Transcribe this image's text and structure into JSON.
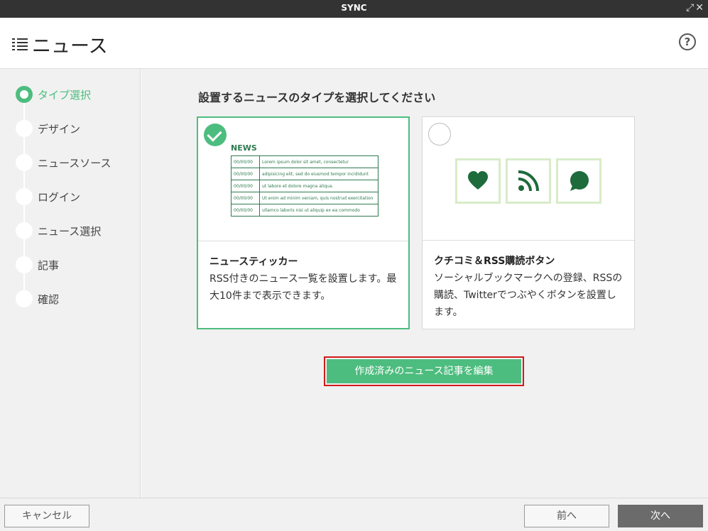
{
  "window": {
    "title": "SYNC"
  },
  "header": {
    "title": "ニュース",
    "help": "?"
  },
  "sidebar": {
    "steps": [
      {
        "label": "タイプ選択",
        "active": true
      },
      {
        "label": "デザイン",
        "active": false
      },
      {
        "label": "ニュースソース",
        "active": false
      },
      {
        "label": "ログイン",
        "active": false
      },
      {
        "label": "ニュース選択",
        "active": false
      },
      {
        "label": "記事",
        "active": false
      },
      {
        "label": "確認",
        "active": false
      }
    ]
  },
  "main": {
    "heading": "設置するニュースのタイプを選択してください",
    "cards": [
      {
        "name": "ニュースティッカー",
        "description": "RSS付きのニュース一覧を設置します。最大10件まで表示できます。",
        "selected": true,
        "preview": {
          "title": "NEWS",
          "rows": [
            {
              "date": "00/00/00",
              "text": "Lorem ipsum dolor sit amet, consectetur"
            },
            {
              "date": "00/00/00",
              "text": "adipisicing elit, sed do eiusmod tempor incididunt"
            },
            {
              "date": "00/00/00",
              "text": "ut labore et dolore magna aliqua."
            },
            {
              "date": "00/00/00",
              "text": "Ut enim ad minim veniam, quis nostrud exercitation"
            },
            {
              "date": "00/00/00",
              "text": "ullamco laboris nisi ut aliquip ex ea commodo"
            }
          ]
        }
      },
      {
        "name": "クチコミ＆RSS購読ボタン",
        "description": "ソーシャルブックマークへの登録、RSSの購読、Twitterでつぶやくボタンを設置します。",
        "selected": false,
        "icons": [
          "heart-icon",
          "rss-icon",
          "speech-bubble-icon"
        ]
      }
    ],
    "edit_button": "作成済みのニュース記事を編集"
  },
  "footer": {
    "cancel": "キャンセル",
    "prev": "前へ",
    "next": "次へ"
  },
  "colors": {
    "accent": "#4dbd7f",
    "dark": "#333333",
    "highlight": "#d11a1a"
  }
}
